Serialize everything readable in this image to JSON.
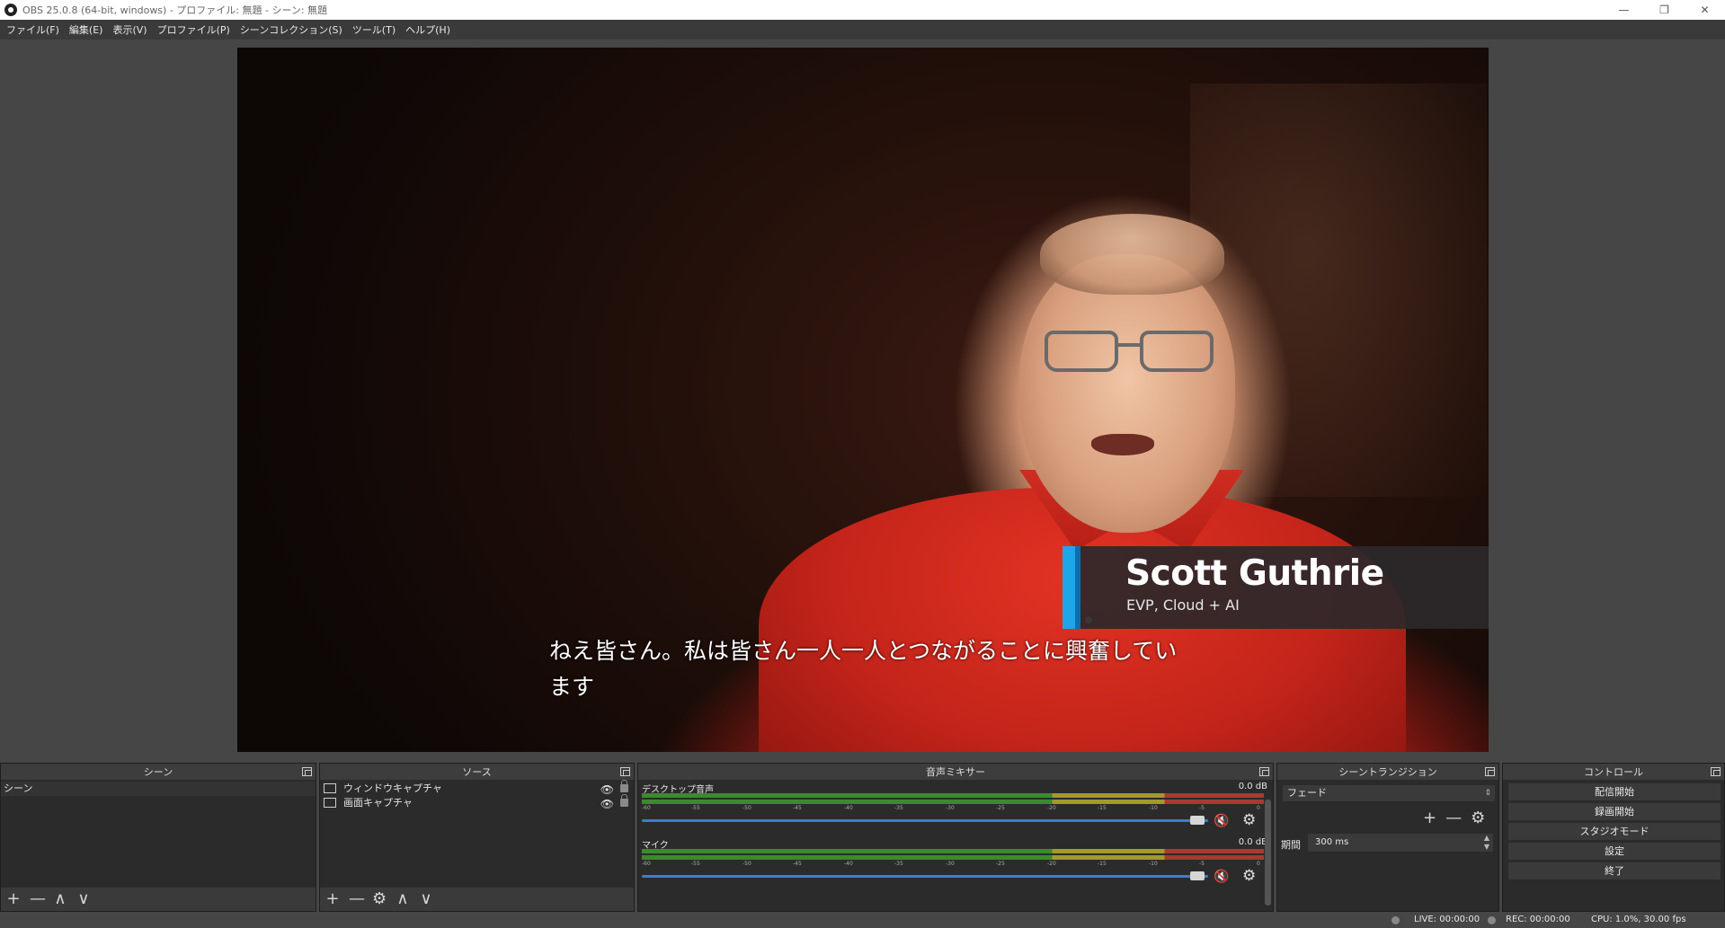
{
  "window": {
    "title": "OBS 25.0.8 (64-bit, windows) - プロファイル: 無題 - シーン: 無題",
    "controls": [
      "—",
      "❐",
      "✕"
    ]
  },
  "menu": [
    "ファイル(F)",
    "編集(E)",
    "表示(V)",
    "プロファイル(P)",
    "シーンコレクション(S)",
    "ツール(T)",
    "ヘルプ(H)"
  ],
  "preview": {
    "lower_third_name": "Scott Guthrie",
    "lower_third_role": "EVP, Cloud + AI",
    "caption_line1": "ねえ皆さん。私は皆さん一人一人とつながることに興奮してい",
    "caption_line2": "ます"
  },
  "scenes": {
    "header": "シーン",
    "items": [
      "シーン"
    ],
    "toolbar": [
      "+",
      "—",
      "∧",
      "∨"
    ]
  },
  "sources": {
    "header": "ソース",
    "items": [
      {
        "label": "ウィンドウキャプチャ",
        "icon": "window-icon"
      },
      {
        "label": "画面キャプチャ",
        "icon": "monitor-icon"
      }
    ],
    "toolbar": [
      "+",
      "—",
      "⚙",
      "∧",
      "∨"
    ]
  },
  "mixer": {
    "header": "音声ミキサー",
    "channels": [
      {
        "label": "デスクトップ音声",
        "db": "0.0 dB"
      },
      {
        "label": "マイク",
        "db": "0.0 dB"
      }
    ],
    "ticks": [
      "-60",
      "-55",
      "-50",
      "-45",
      "-40",
      "-35",
      "-30",
      "-25",
      "-20",
      "-15",
      "-10",
      "-5",
      "0"
    ]
  },
  "transitions": {
    "header": "シーントランジション",
    "selected": "フェード",
    "duration_label": "期間",
    "duration_value": "300 ms"
  },
  "controls": {
    "header": "コントロール",
    "buttons": [
      "配信開始",
      "録画開始",
      "スタジオモード",
      "設定",
      "終了"
    ]
  },
  "status": {
    "live": "LIVE: 00:00:00",
    "rec": "REC: 00:00:00",
    "cpu": "CPU: 1.0%, 30.00 fps"
  },
  "colors": {
    "accent_blue": "#1ea7e8",
    "slider_blue": "#3a7fd0",
    "mute_red": "#e03030"
  }
}
